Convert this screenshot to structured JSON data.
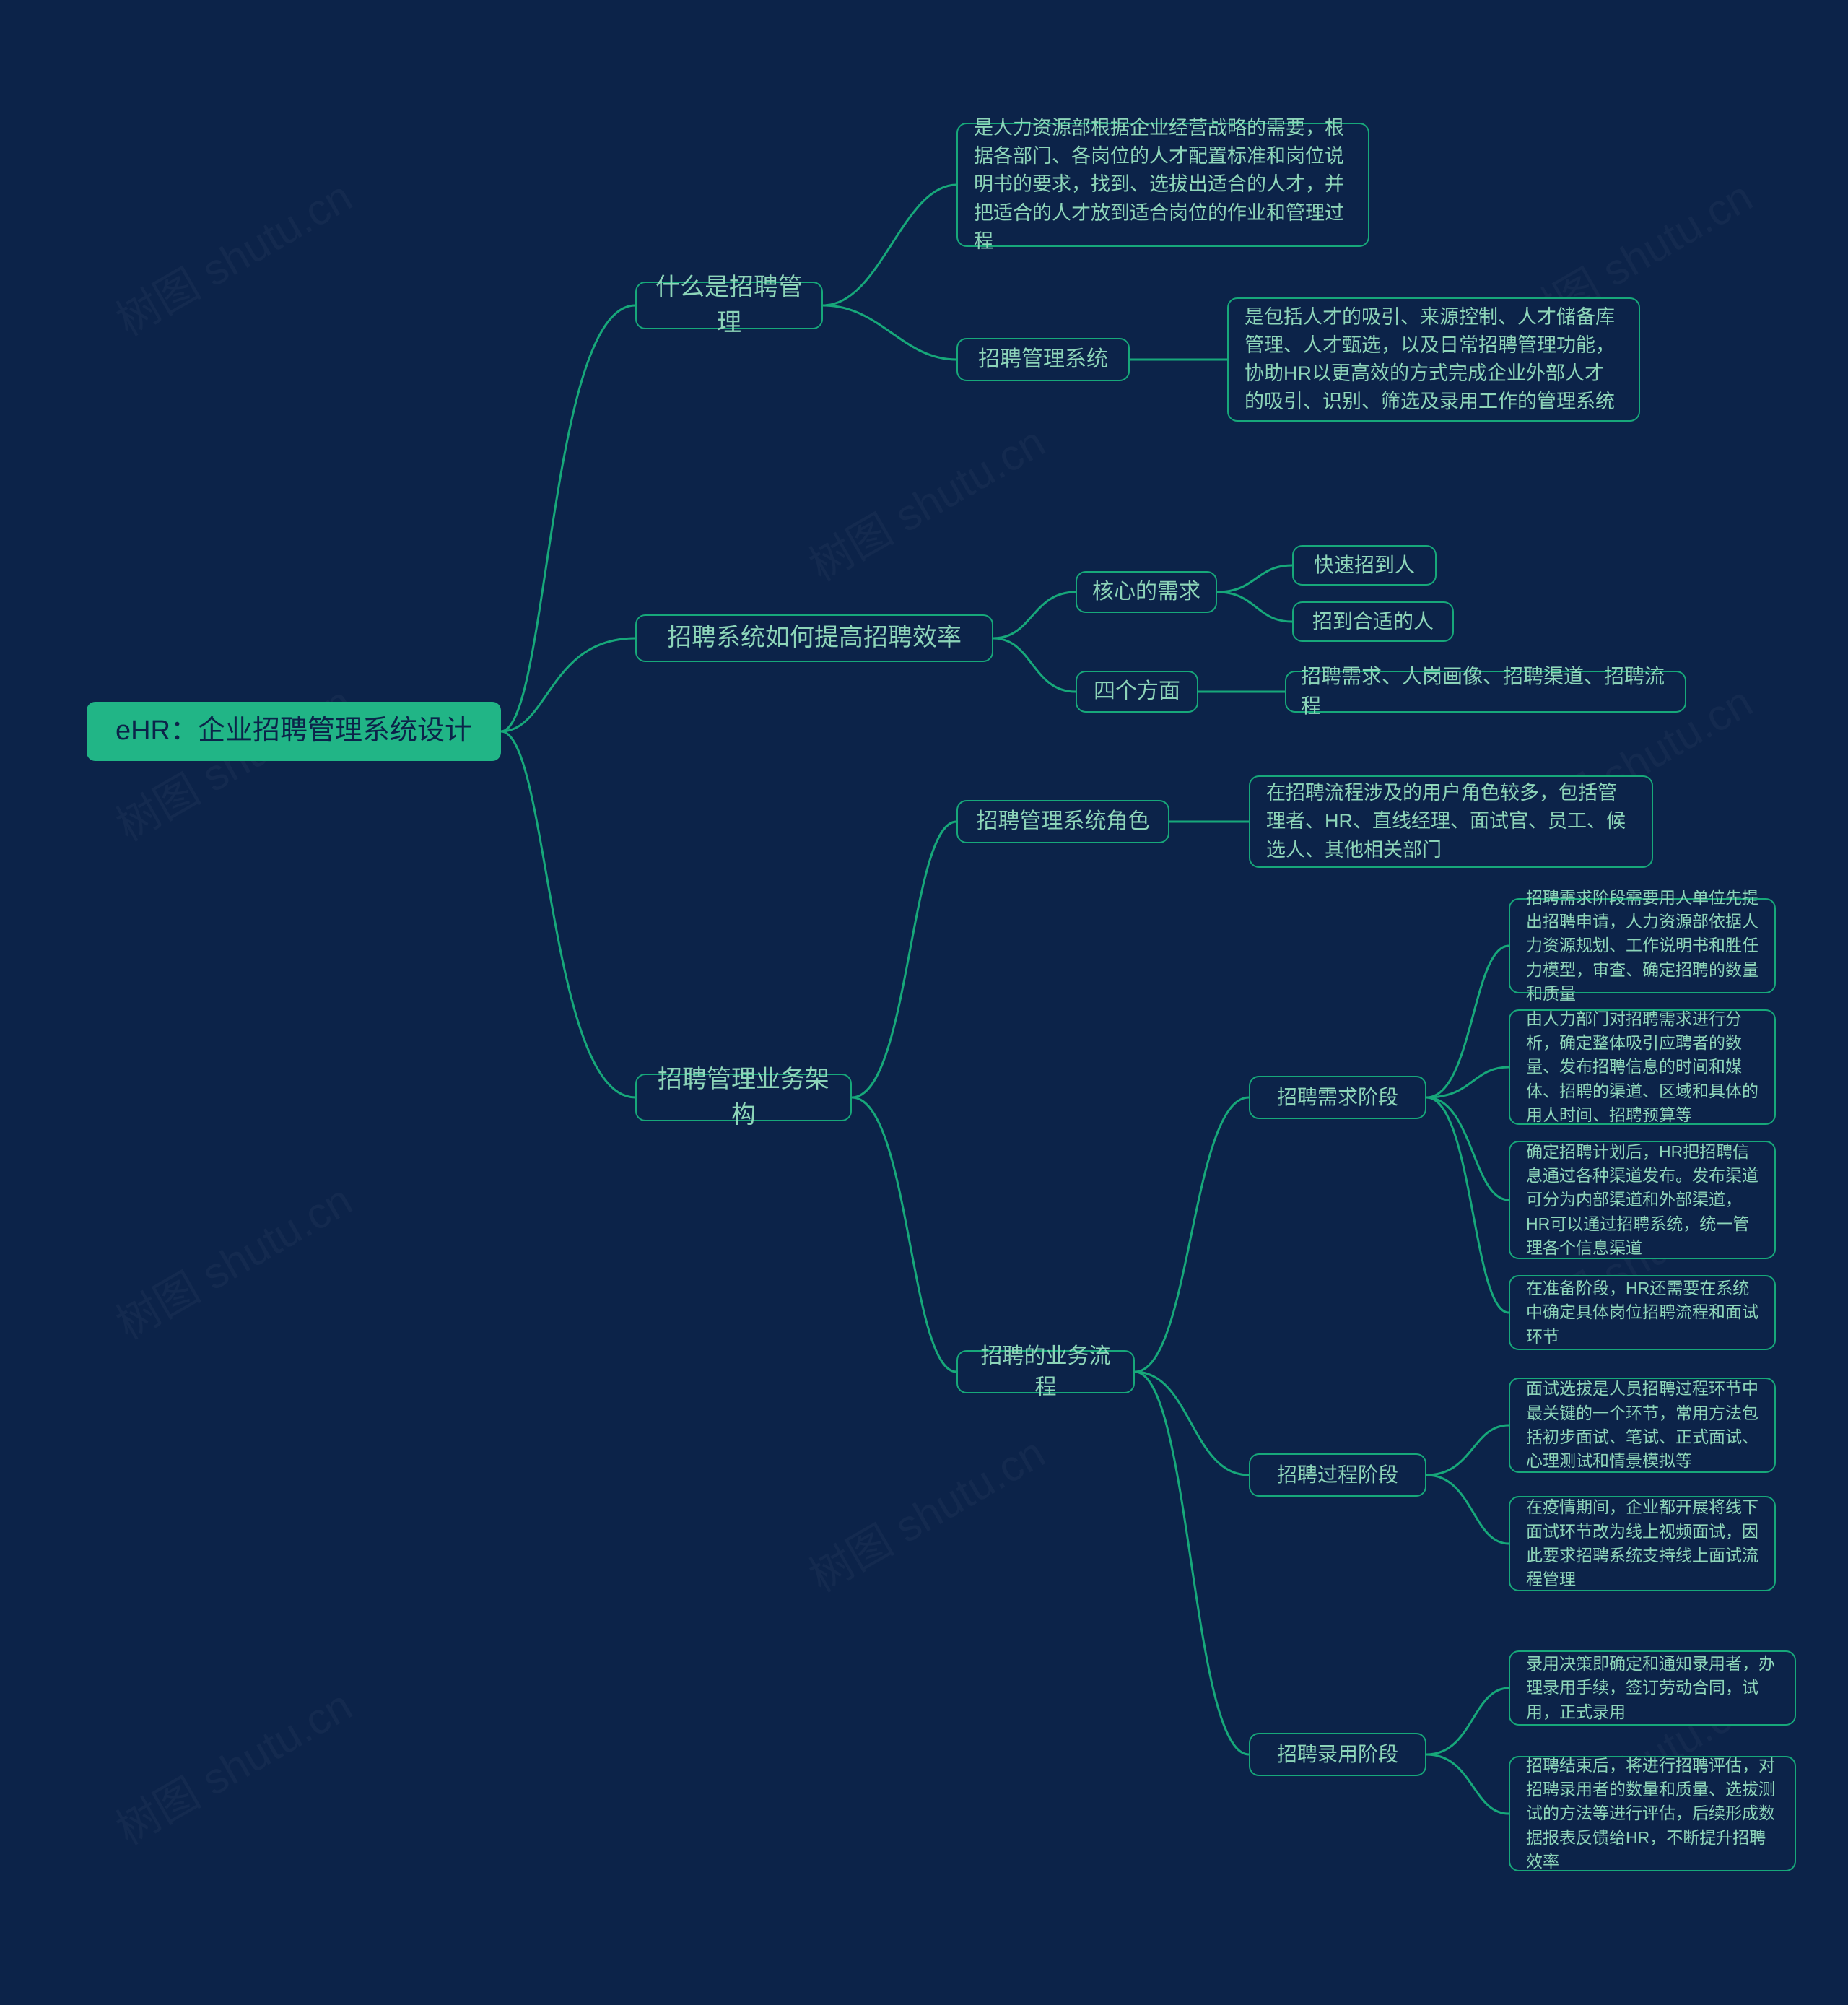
{
  "watermark": "树图 shutu.cn",
  "root": {
    "label": "eHR：企业招聘管理系统设计"
  },
  "n1": {
    "label": "什么是招聘管理"
  },
  "n1a": {
    "label": "是人力资源部根据企业经营战略的需要，根据各部门、各岗位的人才配置标准和岗位说明书的要求，找到、选拔出适合的人才，并把适合的人才放到适合岗位的作业和管理过程"
  },
  "n1b": {
    "label": "招聘管理系统"
  },
  "n1b1": {
    "label": "是包括人才的吸引、来源控制、人才储备库管理、人才甄选，以及日常招聘管理功能，协助HR以更高效的方式完成企业外部人才的吸引、识别、筛选及录用工作的管理系统"
  },
  "n2": {
    "label": "招聘系统如何提高招聘效率"
  },
  "n2a": {
    "label": "核心的需求"
  },
  "n2a1": {
    "label": "快速招到人"
  },
  "n2a2": {
    "label": "招到合适的人"
  },
  "n2b": {
    "label": "四个方面"
  },
  "n2b1": {
    "label": "招聘需求、人岗画像、招聘渠道、招聘流程"
  },
  "n3": {
    "label": "招聘管理业务架构"
  },
  "n3a": {
    "label": "招聘管理系统角色"
  },
  "n3a1": {
    "label": "在招聘流程涉及的用户角色较多，包括管理者、HR、直线经理、面试官、员工、候选人、其他相关部门"
  },
  "n3b": {
    "label": "招聘的业务流程"
  },
  "n3b1": {
    "label": "招聘需求阶段"
  },
  "n3b1a": {
    "label": "招聘需求阶段需要用人单位先提出招聘申请，人力资源部依据人力资源规划、工作说明书和胜任力模型，审查、确定招聘的数量和质量"
  },
  "n3b1b": {
    "label": "由人力部门对招聘需求进行分析，确定整体吸引应聘者的数量、发布招聘信息的时间和媒体、招聘的渠道、区域和具体的用人时间、招聘预算等"
  },
  "n3b1c": {
    "label": "确定招聘计划后，HR把招聘信息通过各种渠道发布。发布渠道可分为内部渠道和外部渠道，HR可以通过招聘系统，统一管理各个信息渠道"
  },
  "n3b1d": {
    "label": "在准备阶段，HR还需要在系统中确定具体岗位招聘流程和面试环节"
  },
  "n3b2": {
    "label": "招聘过程阶段"
  },
  "n3b2a": {
    "label": "面试选拔是人员招聘过程环节中最关键的一个环节，常用方法包括初步面试、笔试、正式面试、心理测试和情景模拟等"
  },
  "n3b2b": {
    "label": "在疫情期间，企业都开展将线下面试环节改为线上视频面试，因此要求招聘系统支持线上面试流程管理"
  },
  "n3b3": {
    "label": "招聘录用阶段"
  },
  "n3b3a": {
    "label": "录用决策即确定和通知录用者，办理录用手续，签订劳动合同，试用，正式录用"
  },
  "n3b3b": {
    "label": "招聘结束后，将进行招聘评估，对招聘录用者的数量和质量、选拔测试的方法等进行评估，后续形成数据报表反馈给HR，不断提升招聘效率"
  }
}
